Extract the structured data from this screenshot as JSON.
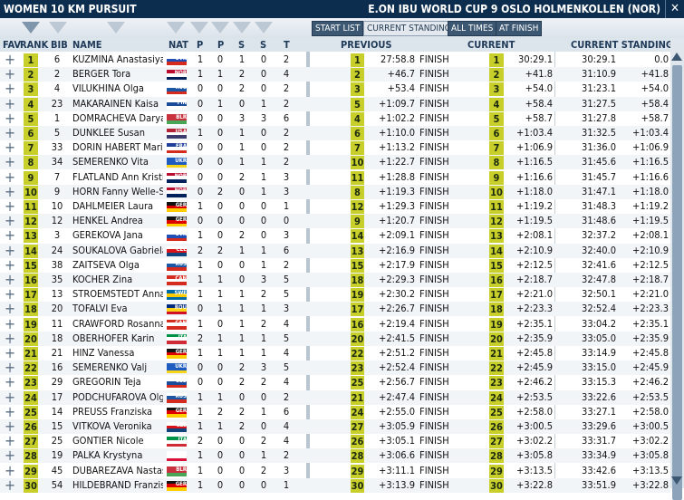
{
  "title": "WOMEN 10 KM PURSUIT",
  "event": "E.ON IBU WORLD CUP 9 OSLO HOLMENKOLLEN (NOR)",
  "close_label": "✕",
  "buttons": {
    "start_list": "START LIST",
    "current_standing": "CURRENT STANDING",
    "all_times": "ALL TIMES",
    "at_finish": "AT FINISH"
  },
  "columns": {
    "fav": "FAV",
    "rank": "RANK",
    "bib": "BIB",
    "name": "NAME",
    "nat": "NAT",
    "p1": "P",
    "p2": "P",
    "s1": "S",
    "s2": "S",
    "t": "T",
    "previous": "PREVIOUS",
    "current": "CURRENT",
    "standing": "CURRENT STANDING"
  },
  "plus_label": "+",
  "rows": [
    {
      "rank": "1",
      "bib": "6",
      "name": "KUZMINA Anastasiya",
      "nat": "SVK",
      "p1": "1",
      "p2": "0",
      "s1": "1",
      "s2": "0",
      "t": "2",
      "prank": "1",
      "ptime": "27:58.8",
      "status": "FINISH",
      "crank": "1",
      "cdiff": "30:29.1",
      "stime": "30:29.1",
      "sdiff": "0.0"
    },
    {
      "rank": "2",
      "bib": "2",
      "name": "BERGER Tora",
      "nat": "NOR",
      "p1": "1",
      "p2": "1",
      "s1": "2",
      "s2": "0",
      "t": "4",
      "prank": "2",
      "ptime": "+46.7",
      "status": "FINISH",
      "crank": "2",
      "cdiff": "+41.8",
      "stime": "31:10.9",
      "sdiff": "+41.8"
    },
    {
      "rank": "3",
      "bib": "4",
      "name": "VILUKHINA Olga",
      "nat": "RUS",
      "p1": "0",
      "p2": "0",
      "s1": "2",
      "s2": "0",
      "t": "2",
      "prank": "3",
      "ptime": "+53.4",
      "status": "FINISH",
      "crank": "3",
      "cdiff": "+54.0",
      "stime": "31:23.1",
      "sdiff": "+54.0"
    },
    {
      "rank": "4",
      "bib": "23",
      "name": "MAKARAINEN Kaisa",
      "nat": "FIN",
      "p1": "0",
      "p2": "1",
      "s1": "0",
      "s2": "1",
      "t": "2",
      "prank": "5",
      "ptime": "+1:09.7",
      "status": "FINISH",
      "crank": "4",
      "cdiff": "+58.4",
      "stime": "31:27.5",
      "sdiff": "+58.4"
    },
    {
      "rank": "5",
      "bib": "1",
      "name": "DOMRACHEVA Darya",
      "nat": "BLR",
      "p1": "0",
      "p2": "0",
      "s1": "3",
      "s2": "3",
      "t": "6",
      "prank": "4",
      "ptime": "+1:02.2",
      "status": "FINISH",
      "crank": "5",
      "cdiff": "+58.7",
      "stime": "31:27.8",
      "sdiff": "+58.7"
    },
    {
      "rank": "6",
      "bib": "5",
      "name": "DUNKLEE Susan",
      "nat": "USA",
      "p1": "1",
      "p2": "0",
      "s1": "1",
      "s2": "0",
      "t": "2",
      "prank": "6",
      "ptime": "+1:10.0",
      "status": "FINISH",
      "crank": "6",
      "cdiff": "+1:03.4",
      "stime": "31:32.5",
      "sdiff": "+1:03.4"
    },
    {
      "rank": "7",
      "bib": "33",
      "name": "DORIN HABERT Marie",
      "nat": "FRA",
      "p1": "0",
      "p2": "0",
      "s1": "1",
      "s2": "0",
      "t": "2",
      "prank": "7",
      "ptime": "+1:13.2",
      "status": "FINISH",
      "crank": "7",
      "cdiff": "+1:06.9",
      "stime": "31:36.0",
      "sdiff": "+1:06.9"
    },
    {
      "rank": "8",
      "bib": "34",
      "name": "SEMERENKO Vita",
      "nat": "UKR",
      "p1": "0",
      "p2": "0",
      "s1": "1",
      "s2": "1",
      "t": "2",
      "prank": "10",
      "ptime": "+1:22.7",
      "status": "FINISH",
      "crank": "8",
      "cdiff": "+1:16.5",
      "stime": "31:45.6",
      "sdiff": "+1:16.5"
    },
    {
      "rank": "9",
      "bib": "7",
      "name": "FLATLAND Ann Kristin",
      "nat": "NOR",
      "p1": "0",
      "p2": "0",
      "s1": "2",
      "s2": "1",
      "t": "3",
      "prank": "11",
      "ptime": "+1:28.8",
      "status": "FINISH",
      "crank": "9",
      "cdiff": "+1:16.6",
      "stime": "31:45.7",
      "sdiff": "+1:16.6"
    },
    {
      "rank": "10",
      "bib": "9",
      "name": "HORN Fanny Welle-St",
      "nat": "NOR",
      "p1": "0",
      "p2": "2",
      "s1": "0",
      "s2": "1",
      "t": "3",
      "prank": "8",
      "ptime": "+1:19.3",
      "status": "FINISH",
      "crank": "10",
      "cdiff": "+1:18.0",
      "stime": "31:47.1",
      "sdiff": "+1:18.0"
    },
    {
      "rank": "11",
      "bib": "10",
      "name": "DAHLMEIER Laura",
      "nat": "GER",
      "p1": "1",
      "p2": "0",
      "s1": "0",
      "s2": "0",
      "t": "1",
      "prank": "12",
      "ptime": "+1:29.3",
      "status": "FINISH",
      "crank": "11",
      "cdiff": "+1:19.2",
      "stime": "31:48.3",
      "sdiff": "+1:19.2"
    },
    {
      "rank": "12",
      "bib": "12",
      "name": "HENKEL Andrea",
      "nat": "GER",
      "p1": "0",
      "p2": "0",
      "s1": "0",
      "s2": "0",
      "t": "0",
      "prank": "9",
      "ptime": "+1:20.7",
      "status": "FINISH",
      "crank": "12",
      "cdiff": "+1:19.5",
      "stime": "31:48.6",
      "sdiff": "+1:19.5"
    },
    {
      "rank": "13",
      "bib": "3",
      "name": "GEREKOVA Jana",
      "nat": "SVK",
      "p1": "1",
      "p2": "0",
      "s1": "2",
      "s2": "0",
      "t": "3",
      "prank": "14",
      "ptime": "+2:09.1",
      "status": "FINISH",
      "crank": "13",
      "cdiff": "+2:08.1",
      "stime": "32:37.2",
      "sdiff": "+2:08.1"
    },
    {
      "rank": "14",
      "bib": "24",
      "name": "SOUKALOVA Gabriela",
      "nat": "CZE",
      "p1": "2",
      "p2": "2",
      "s1": "1",
      "s2": "1",
      "t": "6",
      "prank": "13",
      "ptime": "+2:16.9",
      "status": "FINISH",
      "crank": "14",
      "cdiff": "+2:10.9",
      "stime": "32:40.0",
      "sdiff": "+2:10.9"
    },
    {
      "rank": "15",
      "bib": "38",
      "name": "ZAITSEVA Olga",
      "nat": "RUS",
      "p1": "1",
      "p2": "0",
      "s1": "0",
      "s2": "1",
      "t": "2",
      "prank": "15",
      "ptime": "+2:17.9",
      "status": "FINISH",
      "crank": "15",
      "cdiff": "+2:12.5",
      "stime": "32:41.6",
      "sdiff": "+2:12.5"
    },
    {
      "rank": "16",
      "bib": "35",
      "name": "KOCHER Zina",
      "nat": "CAN",
      "p1": "1",
      "p2": "1",
      "s1": "0",
      "s2": "3",
      "t": "5",
      "prank": "18",
      "ptime": "+2:29.3",
      "status": "FINISH",
      "crank": "16",
      "cdiff": "+2:18.7",
      "stime": "32:47.8",
      "sdiff": "+2:18.7"
    },
    {
      "rank": "17",
      "bib": "13",
      "name": "STROEMSTEDT Anna-L",
      "nat": "SWE",
      "p1": "1",
      "p2": "1",
      "s1": "1",
      "s2": "2",
      "t": "5",
      "prank": "19",
      "ptime": "+2:30.2",
      "status": "FINISH",
      "crank": "17",
      "cdiff": "+2:21.0",
      "stime": "32:50.1",
      "sdiff": "+2:21.0"
    },
    {
      "rank": "18",
      "bib": "20",
      "name": "TOFALVI Eva",
      "nat": "ROU",
      "p1": "0",
      "p2": "1",
      "s1": "1",
      "s2": "1",
      "t": "3",
      "prank": "17",
      "ptime": "+2:26.7",
      "status": "FINISH",
      "crank": "18",
      "cdiff": "+2:23.3",
      "stime": "32:52.4",
      "sdiff": "+2:23.3"
    },
    {
      "rank": "19",
      "bib": "11",
      "name": "CRAWFORD Rosanna",
      "nat": "CAN",
      "p1": "1",
      "p2": "0",
      "s1": "1",
      "s2": "2",
      "t": "4",
      "prank": "16",
      "ptime": "+2:19.4",
      "status": "FINISH",
      "crank": "19",
      "cdiff": "+2:35.1",
      "stime": "33:04.2",
      "sdiff": "+2:35.1"
    },
    {
      "rank": "20",
      "bib": "18",
      "name": "OBERHOFER Karin",
      "nat": "ITA",
      "p1": "2",
      "p2": "1",
      "s1": "1",
      "s2": "1",
      "t": "5",
      "prank": "20",
      "ptime": "+2:41.5",
      "status": "FINISH",
      "crank": "20",
      "cdiff": "+2:35.9",
      "stime": "33:05.0",
      "sdiff": "+2:35.9"
    },
    {
      "rank": "21",
      "bib": "21",
      "name": "HINZ Vanessa",
      "nat": "GER",
      "p1": "1",
      "p2": "1",
      "s1": "1",
      "s2": "1",
      "t": "4",
      "prank": "22",
      "ptime": "+2:51.2",
      "status": "FINISH",
      "crank": "21",
      "cdiff": "+2:45.8",
      "stime": "33:14.9",
      "sdiff": "+2:45.8"
    },
    {
      "rank": "22",
      "bib": "16",
      "name": "SEMERENKO Valj",
      "nat": "UKR",
      "p1": "0",
      "p2": "0",
      "s1": "2",
      "s2": "3",
      "t": "5",
      "prank": "23",
      "ptime": "+2:52.4",
      "status": "FINISH",
      "crank": "22",
      "cdiff": "+2:45.9",
      "stime": "33:15.0",
      "sdiff": "+2:45.9"
    },
    {
      "rank": "23",
      "bib": "29",
      "name": "GREGORIN Teja",
      "nat": "SLO",
      "p1": "0",
      "p2": "0",
      "s1": "2",
      "s2": "2",
      "t": "4",
      "prank": "25",
      "ptime": "+2:56.7",
      "status": "FINISH",
      "crank": "23",
      "cdiff": "+2:46.2",
      "stime": "33:15.3",
      "sdiff": "+2:46.2"
    },
    {
      "rank": "24",
      "bib": "17",
      "name": "PODCHUFAROVA Olga",
      "nat": "RUS",
      "p1": "1",
      "p2": "1",
      "s1": "0",
      "s2": "0",
      "t": "2",
      "prank": "21",
      "ptime": "+2:47.4",
      "status": "FINISH",
      "crank": "24",
      "cdiff": "+2:53.5",
      "stime": "33:22.6",
      "sdiff": "+2:53.5"
    },
    {
      "rank": "25",
      "bib": "14",
      "name": "PREUSS Franziska",
      "nat": "GER",
      "p1": "1",
      "p2": "2",
      "s1": "2",
      "s2": "1",
      "t": "6",
      "prank": "24",
      "ptime": "+2:55.0",
      "status": "FINISH",
      "crank": "25",
      "cdiff": "+2:58.0",
      "stime": "33:27.1",
      "sdiff": "+2:58.0"
    },
    {
      "rank": "26",
      "bib": "15",
      "name": "VITKOVA Veronika",
      "nat": "CZE",
      "p1": "1",
      "p2": "1",
      "s1": "2",
      "s2": "0",
      "t": "4",
      "prank": "27",
      "ptime": "+3:05.9",
      "status": "FINISH",
      "crank": "26",
      "cdiff": "+3:00.5",
      "stime": "33:29.6",
      "sdiff": "+3:00.5"
    },
    {
      "rank": "27",
      "bib": "25",
      "name": "GONTIER Nicole",
      "nat": "ITA",
      "p1": "2",
      "p2": "0",
      "s1": "0",
      "s2": "2",
      "t": "4",
      "prank": "26",
      "ptime": "+3:05.1",
      "status": "FINISH",
      "crank": "27",
      "cdiff": "+3:02.2",
      "stime": "33:31.7",
      "sdiff": "+3:02.2"
    },
    {
      "rank": "28",
      "bib": "19",
      "name": "PALKA Krystyna",
      "nat": "POL",
      "p1": "1",
      "p2": "0",
      "s1": "0",
      "s2": "1",
      "t": "2",
      "prank": "28",
      "ptime": "+3:06.6",
      "status": "FINISH",
      "crank": "28",
      "cdiff": "+3:05.8",
      "stime": "33:34.9",
      "sdiff": "+3:05.8"
    },
    {
      "rank": "29",
      "bib": "45",
      "name": "DUBAREZAVA Nastass",
      "nat": "BLR",
      "p1": "1",
      "p2": "0",
      "s1": "0",
      "s2": "2",
      "t": "3",
      "prank": "29",
      "ptime": "+3:11.1",
      "status": "FINISH",
      "crank": "29",
      "cdiff": "+3:13.5",
      "stime": "33:42.6",
      "sdiff": "+3:13.5"
    },
    {
      "rank": "30",
      "bib": "54",
      "name": "HILDEBRAND Franzisk",
      "nat": "GER",
      "p1": "1",
      "p2": "0",
      "s1": "0",
      "s2": "0",
      "t": "1",
      "prank": "30",
      "ptime": "+3:13.9",
      "status": "FINISH",
      "crank": "30",
      "cdiff": "+3:22.8",
      "stime": "33:51.9",
      "sdiff": "+3:22.8"
    }
  ],
  "flag_colors": {
    "SVK": [
      "#ffffff",
      "#1f4fb5",
      "#d52b1e"
    ],
    "NOR": [
      "#ba0c2f",
      "#ffffff",
      "#00205b"
    ],
    "RUS": [
      "#ffffff",
      "#1c57a5",
      "#d52b1e"
    ],
    "FIN": [
      "#ffffff",
      "#1b4b9b",
      "#ffffff"
    ],
    "BLR": [
      "#c8313e",
      "#c8313e",
      "#4aa657"
    ],
    "USA": [
      "#b22234",
      "#ffffff",
      "#3c3b6e"
    ],
    "FRA": [
      "#1f3f9b",
      "#ffffff",
      "#d52b1e"
    ],
    "UKR": [
      "#1f5cc0",
      "#1f5cc0",
      "#f7d417"
    ],
    "GER": [
      "#111111",
      "#dd0000",
      "#ffce00"
    ],
    "CZE": [
      "#ffffff",
      "#d7141a",
      "#11457e"
    ],
    "CAN": [
      "#d52b1e",
      "#ffffff",
      "#d52b1e"
    ],
    "SWE": [
      "#006aa7",
      "#fecc00",
      "#006aa7"
    ],
    "ROU": [
      "#002b7f",
      "#fcd116",
      "#ce1126"
    ],
    "ITA": [
      "#009246",
      "#ffffff",
      "#ce2b37"
    ],
    "SLO": [
      "#ffffff",
      "#1b4b9b",
      "#d52b1e"
    ],
    "POL": [
      "#ffffff",
      "#ffffff",
      "#dc143c"
    ]
  }
}
